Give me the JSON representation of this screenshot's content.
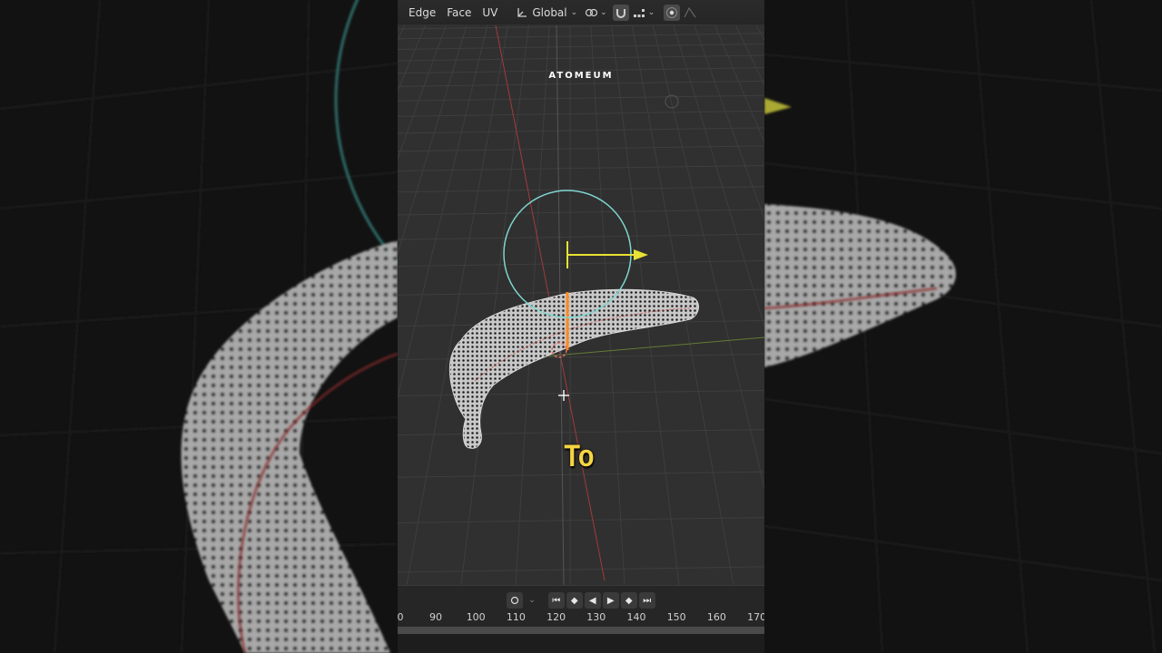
{
  "header": {
    "menus": [
      "Edge",
      "Face",
      "UV"
    ],
    "orientation": "Global"
  },
  "overlay": {
    "watermark": "ATOMEUM",
    "subtitle": "To"
  },
  "timeline": {
    "frame_ticks": [
      "0",
      "90",
      "100",
      "110",
      "120",
      "130",
      "140",
      "150",
      "160",
      "170"
    ]
  },
  "icons": {
    "pivot": "pivot-point-icon",
    "snap": "magnet-snap-icon",
    "snap_increment": "snap-increment-icon",
    "proportional": "proportional-editing-icon",
    "falloff": "falloff-curve-icon",
    "cursor": "move-cursor-icon",
    "gizmo_arrow": "translate-arrow-icon"
  },
  "colors": {
    "viewport_bg": "#303030",
    "grid": "#3c3c3c",
    "x_axis": "#a33a3a",
    "y_axis": "#7a9a3a",
    "gizmo_ring": "#7fd6d0",
    "gizmo_arrow": "#e8e234",
    "selection_edge": "#ff8a1d",
    "subtitle": "#f5d542"
  }
}
